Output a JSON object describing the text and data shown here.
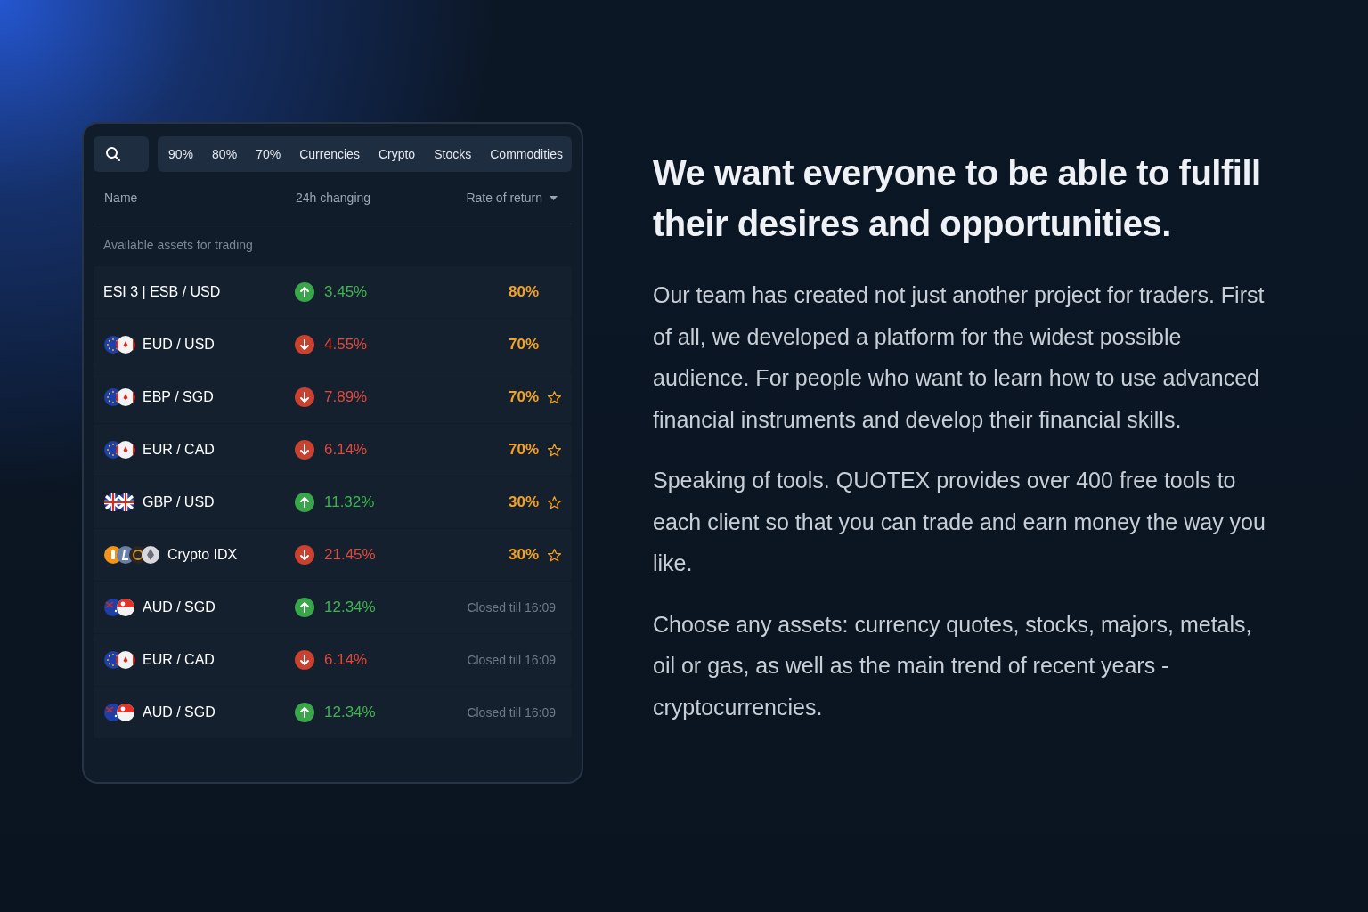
{
  "tabs": [
    {
      "label": "90%",
      "selected": false
    },
    {
      "label": "80%",
      "selected": false
    },
    {
      "label": "70%",
      "selected": false
    },
    {
      "label": "Currencies",
      "selected": false
    },
    {
      "label": "Crypto",
      "selected": false
    },
    {
      "label": "Stocks",
      "selected": false
    },
    {
      "label": "Commodities",
      "selected": false
    }
  ],
  "columns": [
    "Name",
    "24h changing",
    "Rate of return"
  ],
  "section_label": "Available assets for trading",
  "rows": [
    {
      "kind": "open",
      "name": "ESI 3 | ESB / USD",
      "rising": true,
      "change": "3.45%",
      "rate": "80%",
      "starred": false
    },
    {
      "kind": "open",
      "name": "EUD / USD",
      "rising": false,
      "change": "4.55%",
      "rate": "70%",
      "starred": false
    },
    {
      "kind": "open",
      "name": "EBP / SGD",
      "rising": false,
      "change": "7.89%",
      "rate": "70%",
      "starred": true
    },
    {
      "kind": "open",
      "name": "EUR / CAD",
      "rising": false,
      "change": "6.14%",
      "rate": "70%",
      "starred": true
    },
    {
      "kind": "open",
      "name": "GBP / USD",
      "rising": true,
      "change": "11.32%",
      "rate": "30%",
      "starred": true
    },
    {
      "kind": "open",
      "name": "Crypto IDX",
      "rising": false,
      "change": "21.45%",
      "rate": "30%",
      "starred": true
    },
    {
      "kind": "closed",
      "name": "AUD / SGD",
      "rising": true,
      "change": "12.34%",
      "status": "Closed till 16:09"
    },
    {
      "kind": "closed",
      "name": "EUR / CAD",
      "rising": false,
      "change": "6.14%",
      "status": "Closed till 16:09"
    },
    {
      "kind": "closed",
      "name": "AUD / SGD",
      "rising": true,
      "change": "12.34%",
      "status": "Closed till 16:09"
    }
  ],
  "heading": "We want everyone to be able to fulfill their desires and opportunities.",
  "paragraphs": [
    "Our team has created not just another project for traders. First of all, we developed a platform for the widest possible audience. For people who want to learn how to use advanced financial instruments and develop their financial skills.",
    "Speaking of tools. QUOTEX provides over 400 free tools to each client so that you can trade and earn money the way you like.",
    "Choose any assets: currency quotes, stocks, majors, metals, oil or gas, as well as the main trend of recent years - cryptocurrencies."
  ]
}
